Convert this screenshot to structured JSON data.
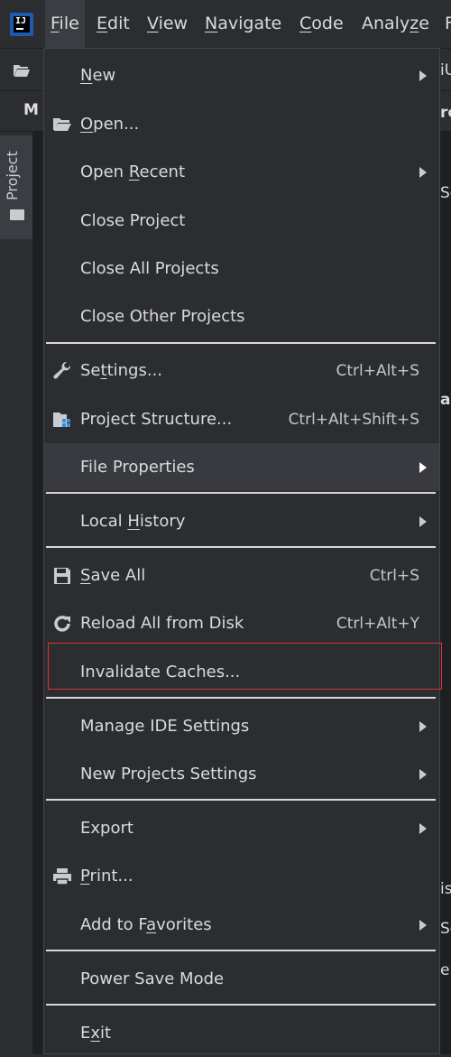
{
  "menubar": {
    "items": [
      {
        "prefix": "",
        "mnemonic": "F",
        "suffix": "ile"
      },
      {
        "prefix": "",
        "mnemonic": "E",
        "suffix": "dit"
      },
      {
        "prefix": "",
        "mnemonic": "V",
        "suffix": "iew"
      },
      {
        "prefix": "",
        "mnemonic": "N",
        "suffix": "avigate"
      },
      {
        "prefix": "",
        "mnemonic": "C",
        "suffix": "ode"
      },
      {
        "prefix": "Analy",
        "mnemonic": "z",
        "suffix": "e"
      },
      {
        "prefix": "",
        "mnemonic": "",
        "suffix": "F"
      }
    ]
  },
  "background": {
    "tab_fragment": "M",
    "project_label": "Project",
    "frag_1": "iU",
    "frag_2": "rc",
    "frag_3": "Sc",
    "frag_4": "ap",
    "frag_5": "is",
    "frag_6": "Sc",
    "frag_7": "e"
  },
  "file_menu": {
    "items": [
      {
        "pre": "",
        "mn": "N",
        "post": "ew",
        "shortcut": "",
        "submenu": true,
        "icon": "none"
      },
      {
        "pre": "",
        "mn": "O",
        "post": "pen...",
        "shortcut": "",
        "submenu": false,
        "icon": "folder-open-icon"
      },
      {
        "pre": "Open ",
        "mn": "R",
        "post": "ecent",
        "shortcut": "",
        "submenu": true,
        "icon": "none"
      },
      {
        "pre": "Close Project",
        "mn": "",
        "post": "",
        "shortcut": "",
        "submenu": false,
        "icon": "none"
      },
      {
        "pre": "Close All Projects",
        "mn": "",
        "post": "",
        "shortcut": "",
        "submenu": false,
        "icon": "none"
      },
      {
        "pre": "Close Other Projects",
        "mn": "",
        "post": "",
        "shortcut": "",
        "submenu": false,
        "icon": "none"
      },
      {
        "pre": "Se",
        "mn": "t",
        "post": "tings...",
        "shortcut": "Ctrl+Alt+S",
        "submenu": false,
        "icon": "wrench-icon"
      },
      {
        "pre": "Project Structure...",
        "mn": "",
        "post": "",
        "shortcut": "Ctrl+Alt+Shift+S",
        "submenu": false,
        "icon": "project-structure-icon"
      },
      {
        "pre": "File Properties",
        "mn": "",
        "post": "",
        "shortcut": "",
        "submenu": true,
        "icon": "none"
      },
      {
        "pre": "Local ",
        "mn": "H",
        "post": "istory",
        "shortcut": "",
        "submenu": true,
        "icon": "none"
      },
      {
        "pre": "",
        "mn": "S",
        "post": "ave All",
        "shortcut": "Ctrl+S",
        "submenu": false,
        "icon": "save-icon"
      },
      {
        "pre": "Reload All from Disk",
        "mn": "",
        "post": "",
        "shortcut": "Ctrl+Alt+Y",
        "submenu": false,
        "icon": "reload-icon"
      },
      {
        "pre": "Invalidate Caches...",
        "mn": "",
        "post": "",
        "shortcut": "",
        "submenu": false,
        "icon": "none"
      },
      {
        "pre": "Manage IDE Settings",
        "mn": "",
        "post": "",
        "shortcut": "",
        "submenu": true,
        "icon": "none"
      },
      {
        "pre": "New Projects Settings",
        "mn": "",
        "post": "",
        "shortcut": "",
        "submenu": true,
        "icon": "none"
      },
      {
        "pre": "Export",
        "mn": "",
        "post": "",
        "shortcut": "",
        "submenu": true,
        "icon": "none"
      },
      {
        "pre": "",
        "mn": "P",
        "post": "rint...",
        "shortcut": "",
        "submenu": false,
        "icon": "print-icon"
      },
      {
        "pre": "Add to F",
        "mn": "a",
        "post": "vorites",
        "shortcut": "",
        "submenu": true,
        "icon": "none"
      },
      {
        "pre": "Power Save Mode",
        "mn": "",
        "post": "",
        "shortcut": "",
        "submenu": false,
        "icon": "none"
      },
      {
        "pre": "E",
        "mn": "x",
        "post": "it",
        "shortcut": "",
        "submenu": false,
        "icon": "none"
      }
    ]
  }
}
